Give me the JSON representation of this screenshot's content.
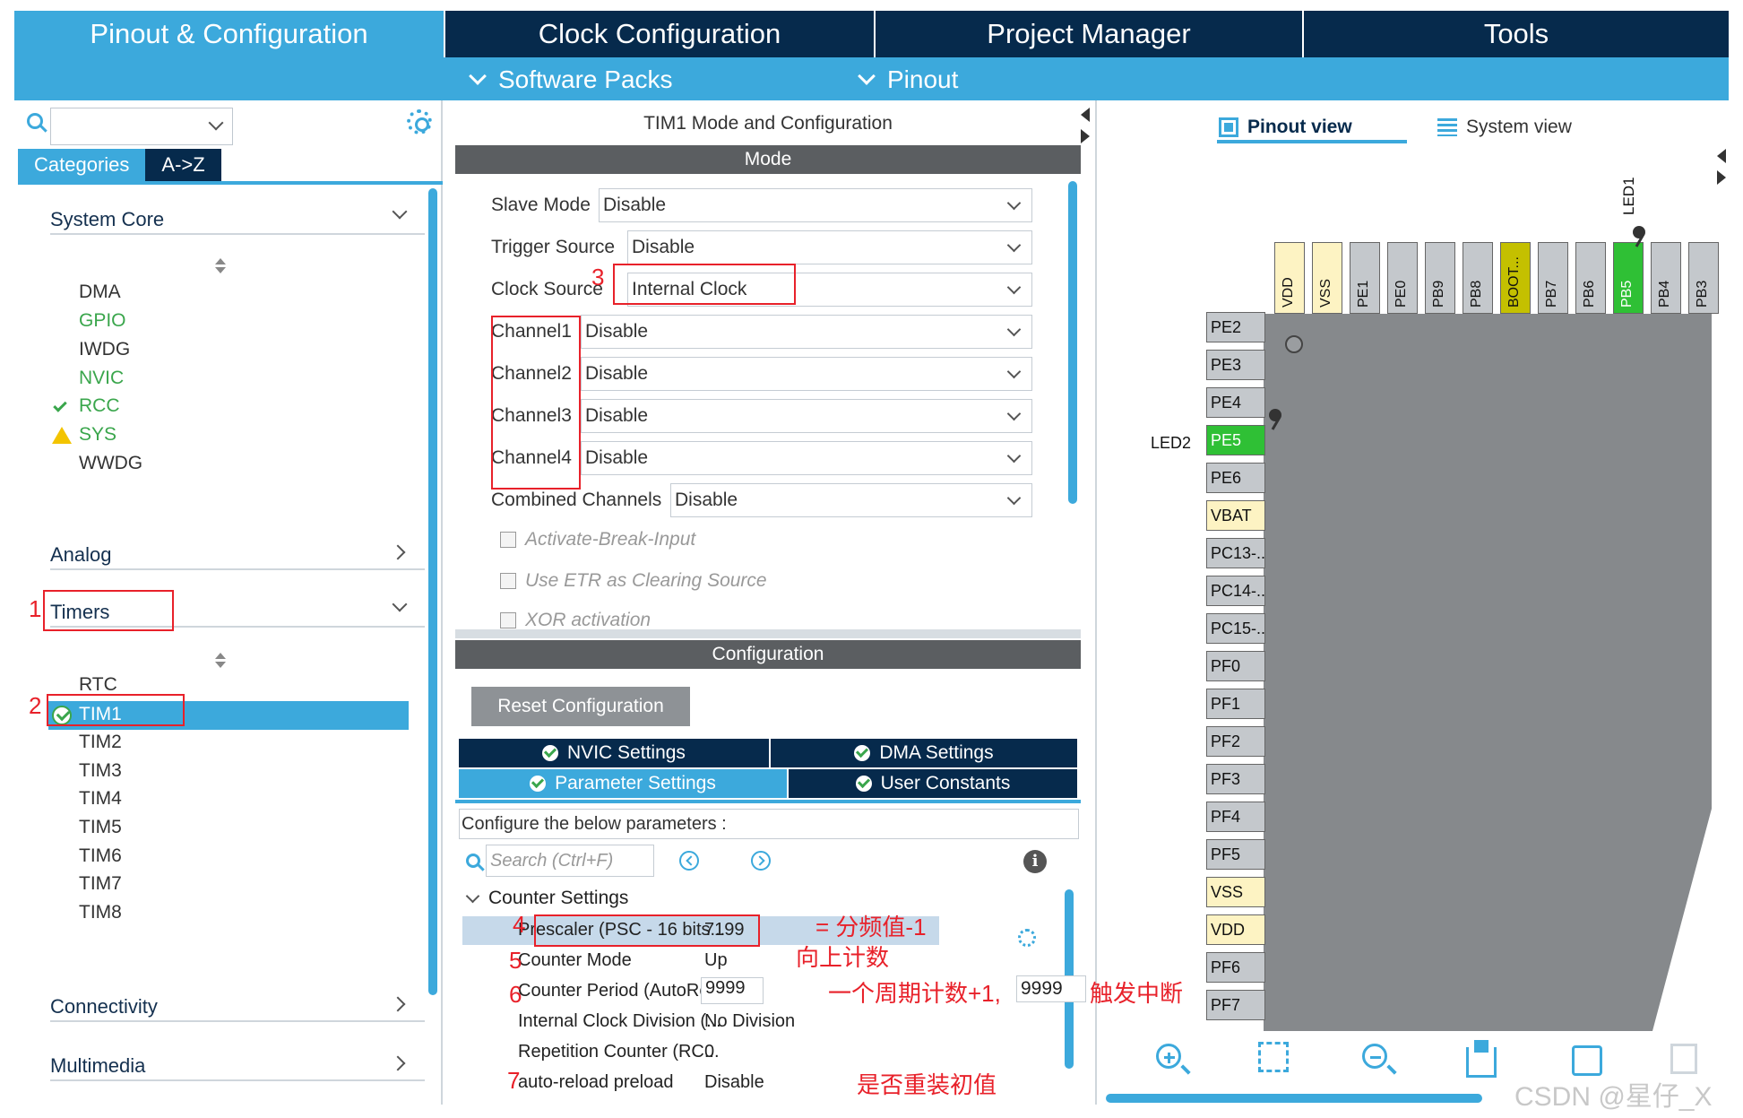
{
  "top_tabs": [
    {
      "label": "Pinout & Configuration",
      "active": true
    },
    {
      "label": "Clock Configuration",
      "active": false
    },
    {
      "label": "Project Manager",
      "active": false
    },
    {
      "label": "Tools",
      "active": false
    }
  ],
  "sub_menu": {
    "software_packs": "Software Packs",
    "pinout": "Pinout"
  },
  "left_panel": {
    "search_value": "",
    "category_tabs": [
      "Categories",
      "A->Z"
    ],
    "sections": {
      "system_core": "System Core",
      "analog": "Analog",
      "timers": "Timers",
      "connectivity": "Connectivity",
      "multimedia": "Multimedia"
    },
    "system_core_items": [
      {
        "label": "DMA",
        "state": "normal"
      },
      {
        "label": "GPIO",
        "state": "configured"
      },
      {
        "label": "IWDG",
        "state": "normal"
      },
      {
        "label": "NVIC",
        "state": "configured"
      },
      {
        "label": "RCC",
        "state": "ok"
      },
      {
        "label": "SYS",
        "state": "warning"
      },
      {
        "label": "WWDG",
        "state": "normal"
      }
    ],
    "timer_items": [
      {
        "label": "RTC",
        "state": "normal"
      },
      {
        "label": "TIM1",
        "state": "selected"
      },
      {
        "label": "TIM2",
        "state": "normal"
      },
      {
        "label": "TIM3",
        "state": "normal"
      },
      {
        "label": "TIM4",
        "state": "normal"
      },
      {
        "label": "TIM5",
        "state": "normal"
      },
      {
        "label": "TIM6",
        "state": "normal"
      },
      {
        "label": "TIM7",
        "state": "normal"
      },
      {
        "label": "TIM8",
        "state": "normal"
      }
    ]
  },
  "mode_panel": {
    "title": "TIM1 Mode and Configuration",
    "mode_header": "Mode",
    "fields": [
      {
        "label": "Slave Mode",
        "value": "Disable"
      },
      {
        "label": "Trigger Source",
        "value": "Disable"
      },
      {
        "label": "Clock Source",
        "value": "Internal Clock"
      },
      {
        "label": "Channel1",
        "value": "Disable"
      },
      {
        "label": "Channel2",
        "value": "Disable"
      },
      {
        "label": "Channel3",
        "value": "Disable"
      },
      {
        "label": "Channel4",
        "value": "Disable"
      },
      {
        "label": "Combined Channels",
        "value": "Disable"
      }
    ],
    "checkboxes": [
      "Activate-Break-Input",
      "Use ETR as Clearing Source",
      "XOR activation"
    ]
  },
  "config_panel": {
    "header": "Configuration",
    "reset_button": "Reset Configuration",
    "tabs": [
      {
        "label": "NVIC Settings",
        "active": false
      },
      {
        "label": "DMA Settings",
        "active": false
      },
      {
        "label": "Parameter Settings",
        "active": true
      },
      {
        "label": "User Constants",
        "active": false
      }
    ],
    "description": "Configure the below parameters :",
    "search_placeholder": "Search (Ctrl+F)",
    "group": "Counter Settings",
    "params": [
      {
        "name": "Prescaler (PSC - 16 bits...",
        "value": "7199"
      },
      {
        "name": "Counter Mode",
        "value": "Up"
      },
      {
        "name": "Counter Period (AutoRel...",
        "value": "9999"
      },
      {
        "name": "Internal Clock Division (...",
        "value": "No Division"
      },
      {
        "name": "Repetition Counter (RC...",
        "value": "0"
      },
      {
        "name": "auto-reload preload",
        "value": "Disable"
      }
    ]
  },
  "pinout_panel": {
    "view_tabs": [
      "Pinout view",
      "System view"
    ],
    "top_pins": [
      "VDD",
      "VSS",
      "PE1",
      "PE0",
      "PB9",
      "PB8",
      "BOOT...",
      "PB7",
      "PB6",
      "PB5",
      "PB4",
      "PB3"
    ],
    "left_pins": [
      "PE2",
      "PE3",
      "PE4",
      "PE5",
      "PE6",
      "VBAT",
      "PC13-...",
      "PC14-...",
      "PC15-...",
      "PF0",
      "PF1",
      "PF2",
      "PF3",
      "PF4",
      "PF5",
      "VSS",
      "VDD",
      "PF6",
      "PF7"
    ],
    "labels": {
      "led1": "LED1",
      "led2": "LED2"
    }
  },
  "annotations": {
    "numbers": [
      "1",
      "2",
      "3",
      "4",
      "5",
      "6",
      "7"
    ],
    "prescaler_note": "= 分频值-1",
    "mode_note": "向上计数",
    "period_note_a": "一个周期计数+1,",
    "period_note_value": "9999",
    "period_note_b": "触发中断",
    "preload_note": "是否重装初值"
  },
  "watermark": "CSDN @星仔_X",
  "colors": {
    "accent": "#3ca9dc",
    "navy": "#062a4c",
    "green": "#3aa64c",
    "annotation": "#e8212a",
    "pin_green": "#2fc035"
  }
}
